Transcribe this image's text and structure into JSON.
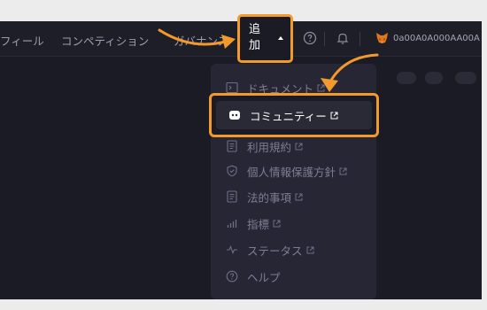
{
  "nav": {
    "items": [
      {
        "label": "フィール"
      },
      {
        "label": "コンペティション"
      },
      {
        "label": "ガバナンス"
      }
    ],
    "more": {
      "label": "追\n加"
    },
    "wallet": {
      "address": "0a00A0A000AA00A"
    }
  },
  "menu": {
    "items": [
      {
        "label": "ドキュメント",
        "icon": "terminal-icon"
      },
      {
        "label": "コミュニティー",
        "icon": "discord-icon"
      },
      {
        "label": "利用規約",
        "icon": "document-icon"
      },
      {
        "label": "個人情報保護方針",
        "icon": "shield-icon"
      },
      {
        "label": "法的事項",
        "icon": "document-icon"
      },
      {
        "label": "指標",
        "icon": "bar-chart-icon"
      },
      {
        "label": "ステータス",
        "icon": "pulse-icon"
      },
      {
        "label": "ヘルプ",
        "icon": "help-icon"
      }
    ]
  },
  "colors": {
    "highlight": "#f39a2c",
    "background": "#1b1b25",
    "menu_bg": "#262634"
  }
}
